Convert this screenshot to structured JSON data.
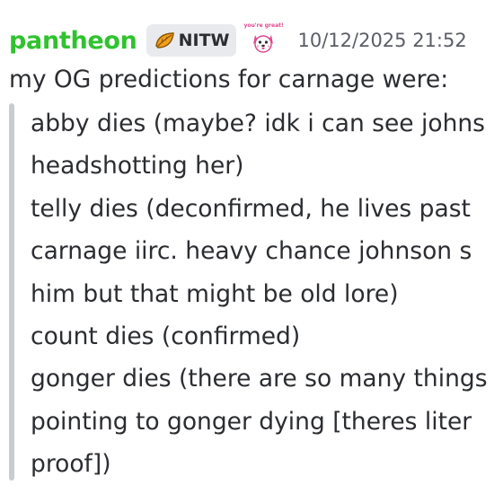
{
  "message": {
    "username": "pantheon",
    "tag": {
      "label": "NITW",
      "icon": "orange-leaf-icon"
    },
    "badge": {
      "text": "you're great!",
      "icon": "pink-dog-icon"
    },
    "timestamp": "10/12/2025 21:52",
    "intro": "my OG predictions for carnage were:",
    "quote_lines": [
      "abby dies (maybe? idk i can see johns",
      "headshotting her)",
      "telly dies (deconfirmed, he lives past",
      "carnage iirc. heavy chance johnson s",
      "him but that might be old lore)",
      "count dies (confirmed)",
      "gonger dies (there are so many things",
      "pointing to gonger dying [theres liter",
      "proof])"
    ]
  },
  "colors": {
    "username": "#2fc32f",
    "tag_background": "#e9eaed",
    "tag_icon": "#f0a020",
    "badge_pink": "#e0488f",
    "quote_bar": "#c9cbd1",
    "text": "#2b2d31",
    "timestamp": "#5c5e66"
  }
}
